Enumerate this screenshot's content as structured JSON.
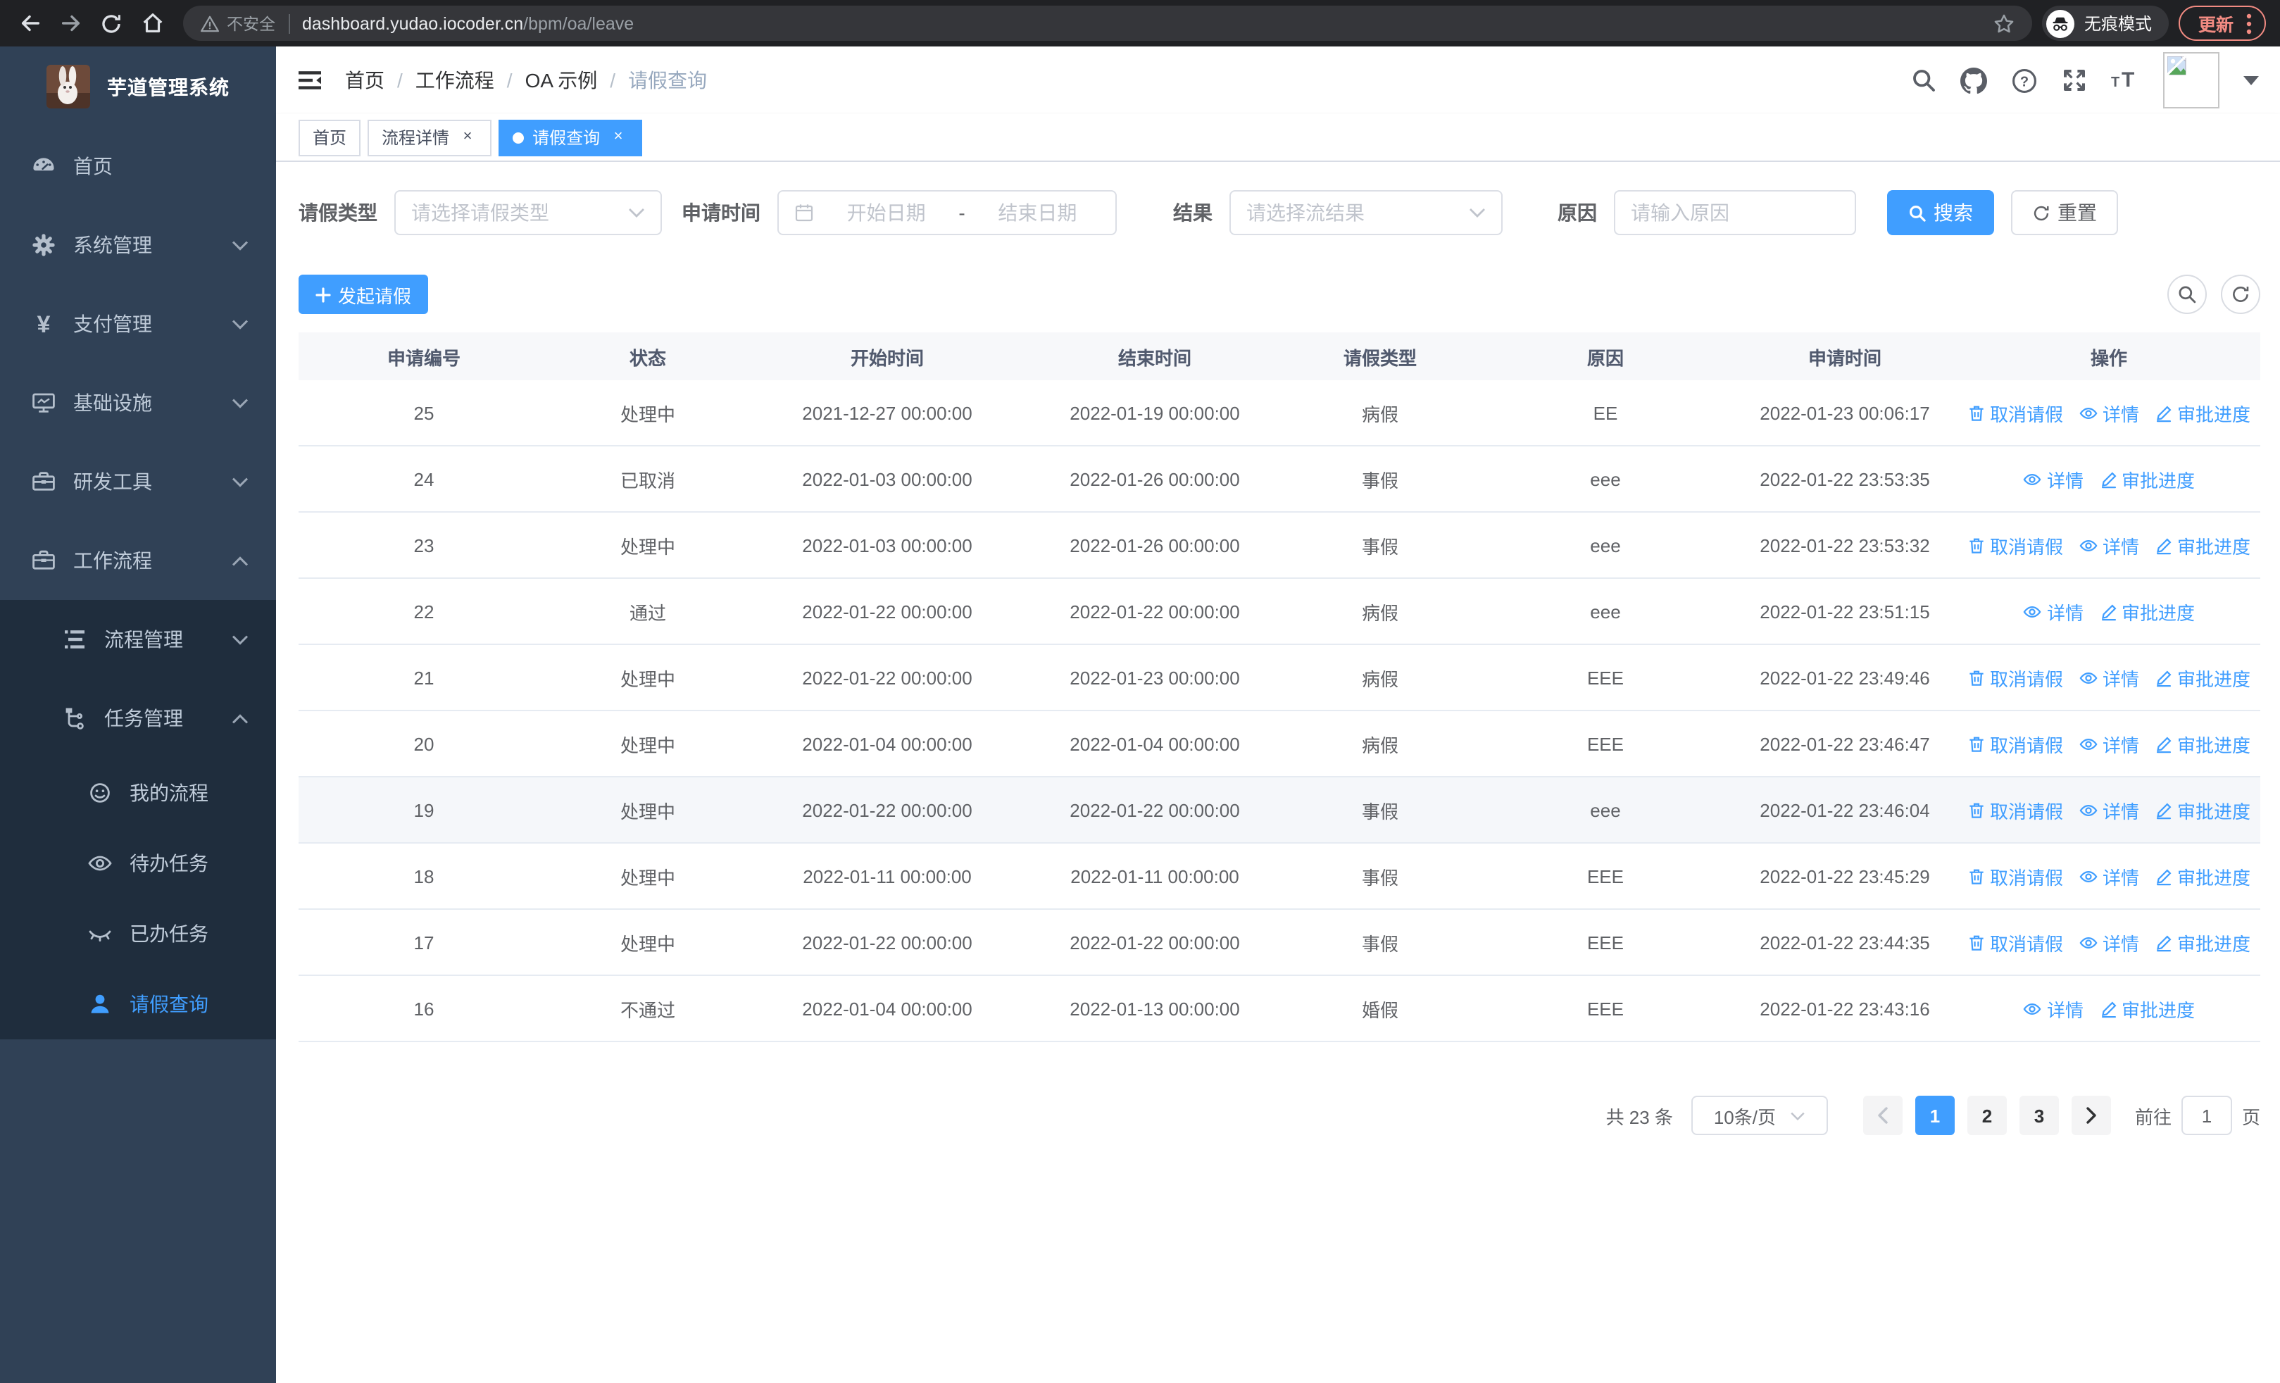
{
  "colors": {
    "primary": "#409eff",
    "sidebar_bg": "#304156",
    "submenu_bg": "#1f2d3d",
    "sidebar_text": "#bfcbd9",
    "chrome_bg": "#202124",
    "update_accent": "#f28b82",
    "table_header_bg": "#f7f8fa",
    "row_hover_bg": "#f5f7fa"
  },
  "browser": {
    "security_label": "不安全",
    "url_host": "dashboard.yudao.iocoder.cn",
    "url_path": "/bpm/oa/leave",
    "incognito_label": "无痕模式",
    "update_label": "更新"
  },
  "sidebar": {
    "title": "芋道管理系统",
    "menu": [
      {
        "label": "首页",
        "icon": "dashboard-icon",
        "level": "root"
      },
      {
        "label": "系统管理",
        "icon": "gear-icon",
        "level": "root",
        "chevron": "down"
      },
      {
        "label": "支付管理",
        "icon": "yen-icon",
        "level": "root",
        "chevron": "down"
      },
      {
        "label": "基础设施",
        "icon": "monitor-icon",
        "level": "root",
        "chevron": "down"
      },
      {
        "label": "研发工具",
        "icon": "toolbox-icon",
        "level": "root",
        "chevron": "down"
      },
      {
        "label": "工作流程",
        "icon": "briefcase-icon",
        "level": "root",
        "chevron": "up"
      },
      {
        "label": "流程管理",
        "icon": "stream-icon",
        "level": "sub",
        "chevron": "down",
        "dark": true
      },
      {
        "label": "任务管理",
        "icon": "flow-icon",
        "level": "sub",
        "chevron": "up",
        "dark": true
      },
      {
        "label": "我的流程",
        "icon": "face-icon",
        "level": "nested",
        "dark": true
      },
      {
        "label": "待办任务",
        "icon": "eye-icon",
        "level": "nested",
        "dark": true
      },
      {
        "label": "已办任务",
        "icon": "eye-closed-icon",
        "level": "nested",
        "dark": true
      },
      {
        "label": "请假查询",
        "icon": "user-icon",
        "level": "nested",
        "dark": true,
        "active": true
      }
    ]
  },
  "header": {
    "breadcrumb": [
      "首页",
      "工作流程",
      "OA 示例",
      "请假查询"
    ]
  },
  "tabs": [
    {
      "label": "首页",
      "closable": false,
      "active": false
    },
    {
      "label": "流程详情",
      "closable": true,
      "active": false
    },
    {
      "label": "请假查询",
      "closable": true,
      "active": true
    }
  ],
  "filters": {
    "leave_type": {
      "label": "请假类型",
      "placeholder": "请选择请假类型"
    },
    "apply_time": {
      "label": "申请时间",
      "start_placeholder": "开始日期",
      "separator": "-",
      "end_placeholder": "结束日期"
    },
    "result": {
      "label": "结果",
      "placeholder": "请选择流结果"
    },
    "reason": {
      "label": "原因",
      "placeholder": "请输入原因"
    },
    "search_label": "搜索",
    "reset_label": "重置"
  },
  "toolbar": {
    "create_label": "发起请假"
  },
  "table": {
    "columns": [
      "申请编号",
      "状态",
      "开始时间",
      "结束时间",
      "请假类型",
      "原因",
      "申请时间",
      "操作"
    ],
    "action_labels": {
      "cancel": "取消请假",
      "detail": "详情",
      "progress": "审批进度"
    },
    "rows": [
      {
        "id": "25",
        "status": "处理中",
        "start": "2021-12-27 00:00:00",
        "end": "2022-01-19 00:00:00",
        "type": "病假",
        "reason": "EE",
        "apply_time": "2022-01-23 00:06:17",
        "actions": [
          "cancel",
          "detail",
          "progress"
        ]
      },
      {
        "id": "24",
        "status": "已取消",
        "start": "2022-01-03 00:00:00",
        "end": "2022-01-26 00:00:00",
        "type": "事假",
        "reason": "eee",
        "apply_time": "2022-01-22 23:53:35",
        "actions": [
          "detail",
          "progress"
        ]
      },
      {
        "id": "23",
        "status": "处理中",
        "start": "2022-01-03 00:00:00",
        "end": "2022-01-26 00:00:00",
        "type": "事假",
        "reason": "eee",
        "apply_time": "2022-01-22 23:53:32",
        "actions": [
          "cancel",
          "detail",
          "progress"
        ]
      },
      {
        "id": "22",
        "status": "通过",
        "start": "2022-01-22 00:00:00",
        "end": "2022-01-22 00:00:00",
        "type": "病假",
        "reason": "eee",
        "apply_time": "2022-01-22 23:51:15",
        "actions": [
          "detail",
          "progress"
        ]
      },
      {
        "id": "21",
        "status": "处理中",
        "start": "2022-01-22 00:00:00",
        "end": "2022-01-23 00:00:00",
        "type": "病假",
        "reason": "EEE",
        "apply_time": "2022-01-22 23:49:46",
        "actions": [
          "cancel",
          "detail",
          "progress"
        ]
      },
      {
        "id": "20",
        "status": "处理中",
        "start": "2022-01-04 00:00:00",
        "end": "2022-01-04 00:00:00",
        "type": "病假",
        "reason": "EEE",
        "apply_time": "2022-01-22 23:46:47",
        "actions": [
          "cancel",
          "detail",
          "progress"
        ]
      },
      {
        "id": "19",
        "status": "处理中",
        "start": "2022-01-22 00:00:00",
        "end": "2022-01-22 00:00:00",
        "type": "事假",
        "reason": "eee",
        "apply_time": "2022-01-22 23:46:04",
        "actions": [
          "cancel",
          "detail",
          "progress"
        ],
        "highlighted": true
      },
      {
        "id": "18",
        "status": "处理中",
        "start": "2022-01-11 00:00:00",
        "end": "2022-01-11 00:00:00",
        "type": "事假",
        "reason": "EEE",
        "apply_time": "2022-01-22 23:45:29",
        "actions": [
          "cancel",
          "detail",
          "progress"
        ]
      },
      {
        "id": "17",
        "status": "处理中",
        "start": "2022-01-22 00:00:00",
        "end": "2022-01-22 00:00:00",
        "type": "事假",
        "reason": "EEE",
        "apply_time": "2022-01-22 23:44:35",
        "actions": [
          "cancel",
          "detail",
          "progress"
        ]
      },
      {
        "id": "16",
        "status": "不通过",
        "start": "2022-01-04 00:00:00",
        "end": "2022-01-13 00:00:00",
        "type": "婚假",
        "reason": "EEE",
        "apply_time": "2022-01-22 23:43:16",
        "actions": [
          "detail",
          "progress"
        ]
      }
    ]
  },
  "pagination": {
    "total_label": "共 23 条",
    "page_size_label": "10条/页",
    "pages": [
      "1",
      "2",
      "3"
    ],
    "active_page": "1",
    "goto_label": "前往",
    "goto_value": "1",
    "page_unit": "页"
  }
}
